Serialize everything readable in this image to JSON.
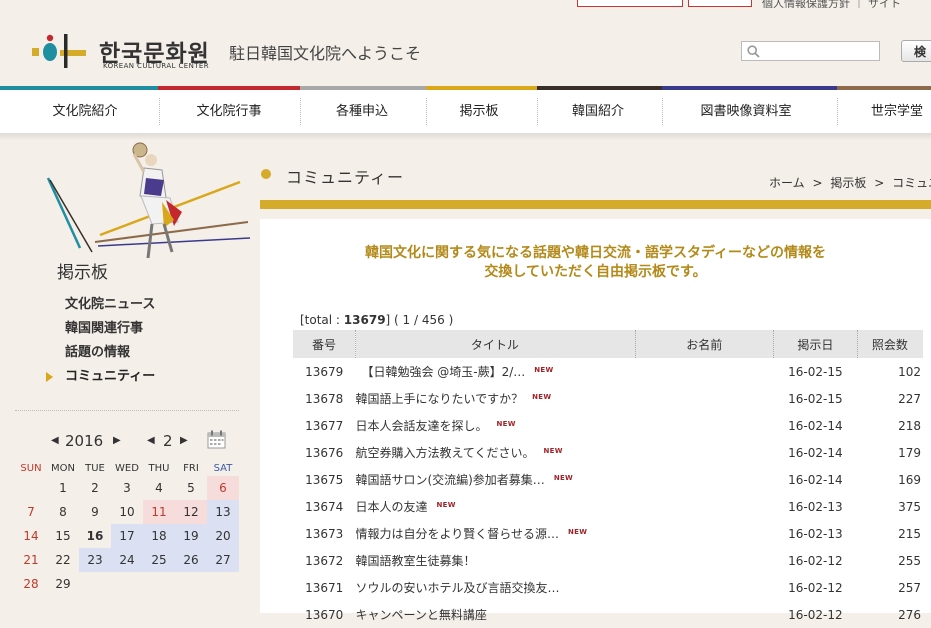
{
  "header": {
    "logo_kr": "한국문화원",
    "logo_en": "KOREAN CULTURAL CENTER",
    "welcome": "駐日韓国文化院へようこそ",
    "search_placeholder": "",
    "search_button": "検",
    "top_chip_1": "",
    "top_chip_2": "",
    "top_text": "個人情報保護方針 ｜ サイト"
  },
  "colors": {
    "accent_gold": "#d4ab2a",
    "intro_text": "#b38a1a",
    "new_badge": "#a0232a",
    "nav_bar": [
      "#1e8ea0",
      "#c2282d",
      "#a8a8a8",
      "#d9a71a",
      "#3a2e29",
      "#3a3a8c",
      "#8c6a4a"
    ]
  },
  "nav": {
    "items": [
      {
        "label": "文化院紹介"
      },
      {
        "label": "文化院行事"
      },
      {
        "label": "各種申込"
      },
      {
        "label": "掲示板"
      },
      {
        "label": "韓国紹介"
      },
      {
        "label": "図書映像資料室"
      },
      {
        "label": "世宗学堂"
      }
    ]
  },
  "sidebar": {
    "section_title": "掲示板",
    "menu": [
      {
        "label": "文化院ニュース"
      },
      {
        "label": "韓国関連行事"
      },
      {
        "label": "話題の情報"
      },
      {
        "label": "コミュニティー",
        "active": true
      }
    ],
    "calendar": {
      "prev_year": "◀",
      "year": "2016",
      "next_year": "▶",
      "prev_month": "◀",
      "month": "2",
      "next_month": "▶",
      "icon": "calendar-icon",
      "weekdays": [
        "SUN",
        "MON",
        "TUE",
        "WED",
        "THU",
        "FRI",
        "SAT"
      ],
      "weeks": [
        [
          "",
          "1",
          "2",
          "3",
          "4",
          "5",
          "6"
        ],
        [
          "7",
          "8",
          "9",
          "10",
          "11",
          "12",
          "13"
        ],
        [
          "14",
          "15",
          "16",
          "17",
          "18",
          "19",
          "20"
        ],
        [
          "21",
          "22",
          "23",
          "24",
          "25",
          "26",
          "27"
        ],
        [
          "28",
          "29",
          "",
          "",
          "",
          "",
          ""
        ]
      ],
      "today": "16",
      "holidays": [
        "11",
        "12"
      ]
    }
  },
  "page": {
    "title": "コミュニティー",
    "breadcrumb": [
      "ホーム",
      "掲示板",
      "コミュニテ"
    ],
    "breadcrumb_sep": ">",
    "intro_line1": "韓国文化に関する気になる話題や韓日交流・語学スタディーなどの情報を",
    "intro_line2": "交換していただく自由掲示板です。",
    "total_prefix": "[total : ",
    "total_count": "13679",
    "total_suffix": "] ( 1 / 456 )"
  },
  "board": {
    "columns": [
      "番号",
      "タイトル",
      "お名前",
      "掲示日",
      "照会数"
    ],
    "new_label": "NEW",
    "rows": [
      {
        "no": "13679",
        "title": "　【日韓勉強会 @埼玉-蕨】2/…",
        "name": "",
        "date": "16-02-15",
        "views": "102",
        "new": true
      },
      {
        "no": "13678",
        "title": "韓国語上手になりたいですか？",
        "name": "",
        "date": "16-02-15",
        "views": "227",
        "new": true
      },
      {
        "no": "13677",
        "title": "日本人会話友達を探し。",
        "name": "",
        "date": "16-02-14",
        "views": "218",
        "new": true
      },
      {
        "no": "13676",
        "title": "航空券購入方法教えてください。",
        "name": "",
        "date": "16-02-14",
        "views": "179",
        "new": true
      },
      {
        "no": "13675",
        "title": "韓国語サロン(交流編)参加者募集…",
        "name": "",
        "date": "16-02-14",
        "views": "169",
        "new": true
      },
      {
        "no": "13674",
        "title": "日本人の友達",
        "name": "",
        "date": "16-02-13",
        "views": "375",
        "new": true
      },
      {
        "no": "13673",
        "title": "情報力は自分をより賢く督らせる源…",
        "name": "",
        "date": "16-02-13",
        "views": "215",
        "new": true
      },
      {
        "no": "13672",
        "title": "韓国語教室生徒募集！",
        "name": "",
        "date": "16-02-12",
        "views": "255",
        "new": false
      },
      {
        "no": "13671",
        "title": "ソウルの安いホテル及び言語交換友…",
        "name": "",
        "date": "16-02-12",
        "views": "257",
        "new": false
      },
      {
        "no": "13670",
        "title": "キャンペーンと無料講座",
        "name": "",
        "date": "16-02-12",
        "views": "276",
        "new": false
      }
    ]
  }
}
